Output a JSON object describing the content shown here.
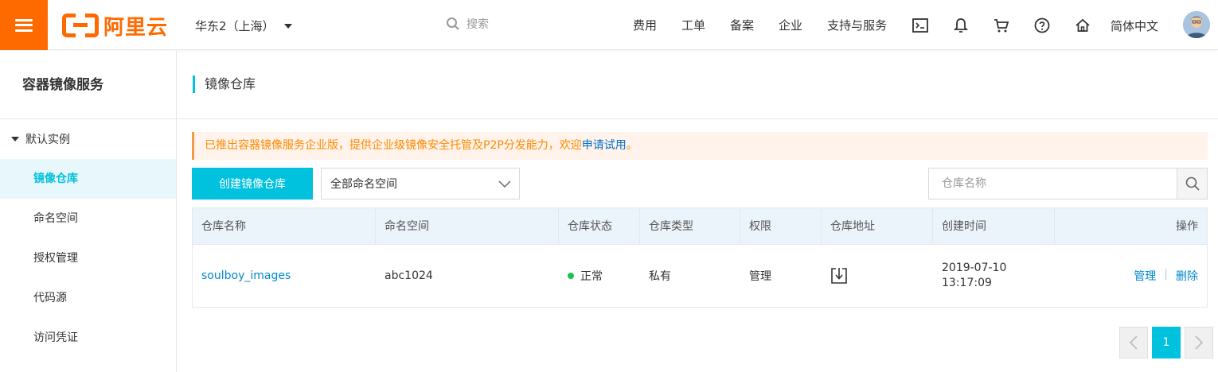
{
  "topbar": {
    "logo_text": "阿里云",
    "region": "华东2（上海）",
    "search_placeholder": "搜索",
    "nav": [
      "费用",
      "工单",
      "备案",
      "企业",
      "支持与服务"
    ],
    "icons": [
      "terminal-icon",
      "bell-icon",
      "cart-icon",
      "help-icon",
      "home-icon"
    ],
    "language": "简体中文"
  },
  "sidebar": {
    "title": "容器镜像服务",
    "group_label": "默认实例",
    "items": [
      {
        "label": "镜像仓库",
        "active": true
      },
      {
        "label": "命名空间"
      },
      {
        "label": "授权管理"
      },
      {
        "label": "代码源"
      },
      {
        "label": "访问凭证"
      }
    ]
  },
  "main": {
    "title": "镜像仓库",
    "notice": {
      "text": "已推出容器镜像服务企业版，提供企业级镜像安全托管及P2P分发能力，欢迎",
      "link": "申请试用",
      "end": "。"
    },
    "create_button": "创建镜像仓库",
    "namespace_select": "全部命名空间",
    "search_placeholder": "仓库名称",
    "table": {
      "headers": [
        "仓库名称",
        "命名空间",
        "仓库状态",
        "仓库类型",
        "权限",
        "仓库地址",
        "创建时间",
        "操作"
      ],
      "rows": [
        {
          "name": "soulboy_images",
          "namespace": "abc1024",
          "status": "正常",
          "type": "私有",
          "permission": "管理",
          "created_date": "2019-07-10",
          "created_time": "13:17:09",
          "op_manage": "管理",
          "op_delete": "删除"
        }
      ]
    },
    "pagination": {
      "current": "1"
    }
  },
  "colors": {
    "brand": "#ff6a00",
    "accent": "#00c1de",
    "link": "#0088cc",
    "status_ok": "#1bc34a"
  }
}
